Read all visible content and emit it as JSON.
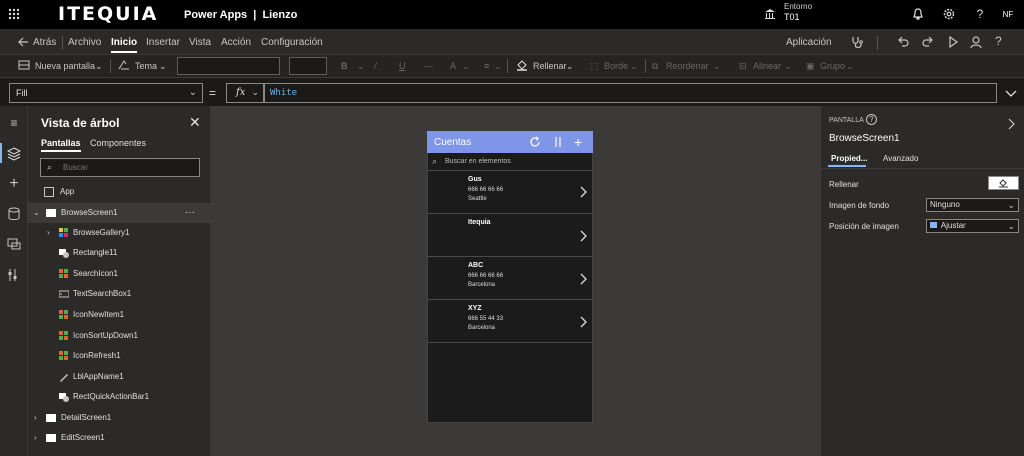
{
  "topbar": {
    "brand": "ITEQUIA",
    "app_title": "Power Apps  |  Lienzo",
    "environment_label": "Entorno",
    "environment_value": "T01",
    "avatar": "NF"
  },
  "menu": {
    "back": "Atrás",
    "items": [
      "Archivo",
      "Inicio",
      "Insertar",
      "Vista",
      "Acción",
      "Configuración"
    ],
    "right_label": "Aplicación"
  },
  "toolbar": {
    "new_screen": "Nueva pantalla",
    "theme": "Tema",
    "fill": "Rellenar",
    "border": "Borde",
    "reorder": "Reordenar",
    "align": "Alinear",
    "group": "Grupo"
  },
  "formula": {
    "property": "Fill",
    "fx": "fx",
    "expression": "White"
  },
  "tree": {
    "title": "Vista de árbol",
    "tabs": [
      "Pantallas",
      "Componentes"
    ],
    "search_placeholder": "Buscar",
    "app": "App",
    "screens": [
      {
        "name": "BrowseScreen1"
      },
      {
        "name": "DetailScreen1"
      },
      {
        "name": "EditScreen1"
      }
    ],
    "children": [
      "BrowseGallery1",
      "Rectangle11",
      "SearchIcon1",
      "TextSearchBox1",
      "IconNewItem1",
      "IconSortUpDown1",
      "IconRefresh1",
      "LblAppName1",
      "RectQuickActionBar1"
    ]
  },
  "phone": {
    "title": "Cuentas",
    "search_placeholder": "Buscar en elementos",
    "items": [
      {
        "name": "Gus",
        "phone": "666 66 66 66",
        "city": "Seattle"
      },
      {
        "name": "Itequia",
        "phone": "",
        "city": ""
      },
      {
        "name": "ABC",
        "phone": "666 66 66 66",
        "city": "Barcelona"
      },
      {
        "name": "XYZ",
        "phone": "666 55 44 33",
        "city": "Barcelona"
      }
    ]
  },
  "props": {
    "section": "PANTALLA",
    "screen_name": "BrowseScreen1",
    "tabs": [
      "Propied...",
      "Avanzado"
    ],
    "fill_label": "Rellenar",
    "bg_image_label": "Imagen de fondo",
    "bg_image_value": "Ninguno",
    "image_pos_label": "Posición de imagen",
    "image_pos_value": "Ajustar"
  }
}
